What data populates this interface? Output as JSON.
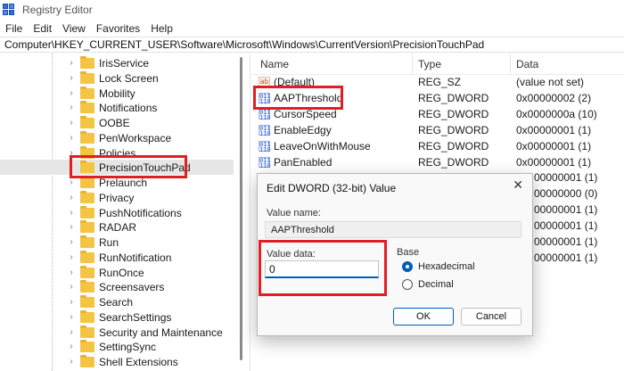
{
  "window": {
    "title": "Registry Editor"
  },
  "menu": [
    "File",
    "Edit",
    "View",
    "Favorites",
    "Help"
  ],
  "address": "Computer\\HKEY_CURRENT_USER\\Software\\Microsoft\\Windows\\CurrentVersion\\PrecisionTouchPad",
  "tree": {
    "items": [
      {
        "label": "IrisService"
      },
      {
        "label": "Lock Screen"
      },
      {
        "label": "Mobility"
      },
      {
        "label": "Notifications"
      },
      {
        "label": "OOBE"
      },
      {
        "label": "PenWorkspace"
      },
      {
        "label": "Policies"
      },
      {
        "label": "PrecisionTouchPad"
      },
      {
        "label": "Prelaunch"
      },
      {
        "label": "Privacy"
      },
      {
        "label": "PushNotifications"
      },
      {
        "label": "RADAR"
      },
      {
        "label": "Run"
      },
      {
        "label": "RunNotification"
      },
      {
        "label": "RunOnce"
      },
      {
        "label": "Screensavers"
      },
      {
        "label": "Search"
      },
      {
        "label": "SearchSettings"
      },
      {
        "label": "Security and Maintenance"
      },
      {
        "label": "SettingSync"
      },
      {
        "label": "Shell Extensions"
      }
    ],
    "selected": "PrecisionTouchPad"
  },
  "list": {
    "headers": {
      "name": "Name",
      "type": "Type",
      "data": "Data"
    },
    "rows": [
      {
        "icon": "ab",
        "name": "(Default)",
        "type": "REG_SZ",
        "data": "(value not set)"
      },
      {
        "icon": "dword",
        "name": "AAPThreshold",
        "type": "REG_DWORD",
        "data": "0x00000002 (2)"
      },
      {
        "icon": "dword",
        "name": "CursorSpeed",
        "type": "REG_DWORD",
        "data": "0x0000000a (10)"
      },
      {
        "icon": "dword",
        "name": "EnableEdgy",
        "type": "REG_DWORD",
        "data": "0x00000001 (1)"
      },
      {
        "icon": "dword",
        "name": "LeaveOnWithMouse",
        "type": "REG_DWORD",
        "data": "0x00000001 (1)"
      },
      {
        "icon": "dword",
        "name": "PanEnabled",
        "type": "REG_DWORD",
        "data": "0x00000001 (1)"
      }
    ],
    "hidden_data": [
      "00000001 (1)",
      "00000000 (0)",
      "00000001 (1)",
      "00000001 (1)",
      "00000001 (1)",
      "00000001 (1)"
    ]
  },
  "dialog": {
    "title": "Edit DWORD (32-bit) Value",
    "close": "✕",
    "value_name_label": "Value name:",
    "value_name": "AAPThreshold",
    "value_data_label": "Value data:",
    "value_data": "0",
    "base_label": "Base",
    "base_options": [
      {
        "label": "Hexadecimal",
        "selected": true
      },
      {
        "label": "Decimal",
        "selected": false
      }
    ],
    "ok": "OK",
    "cancel": "Cancel"
  },
  "colors": {
    "highlight": "#e01e23",
    "accent": "#005fb8",
    "folder": "#f4c542"
  }
}
